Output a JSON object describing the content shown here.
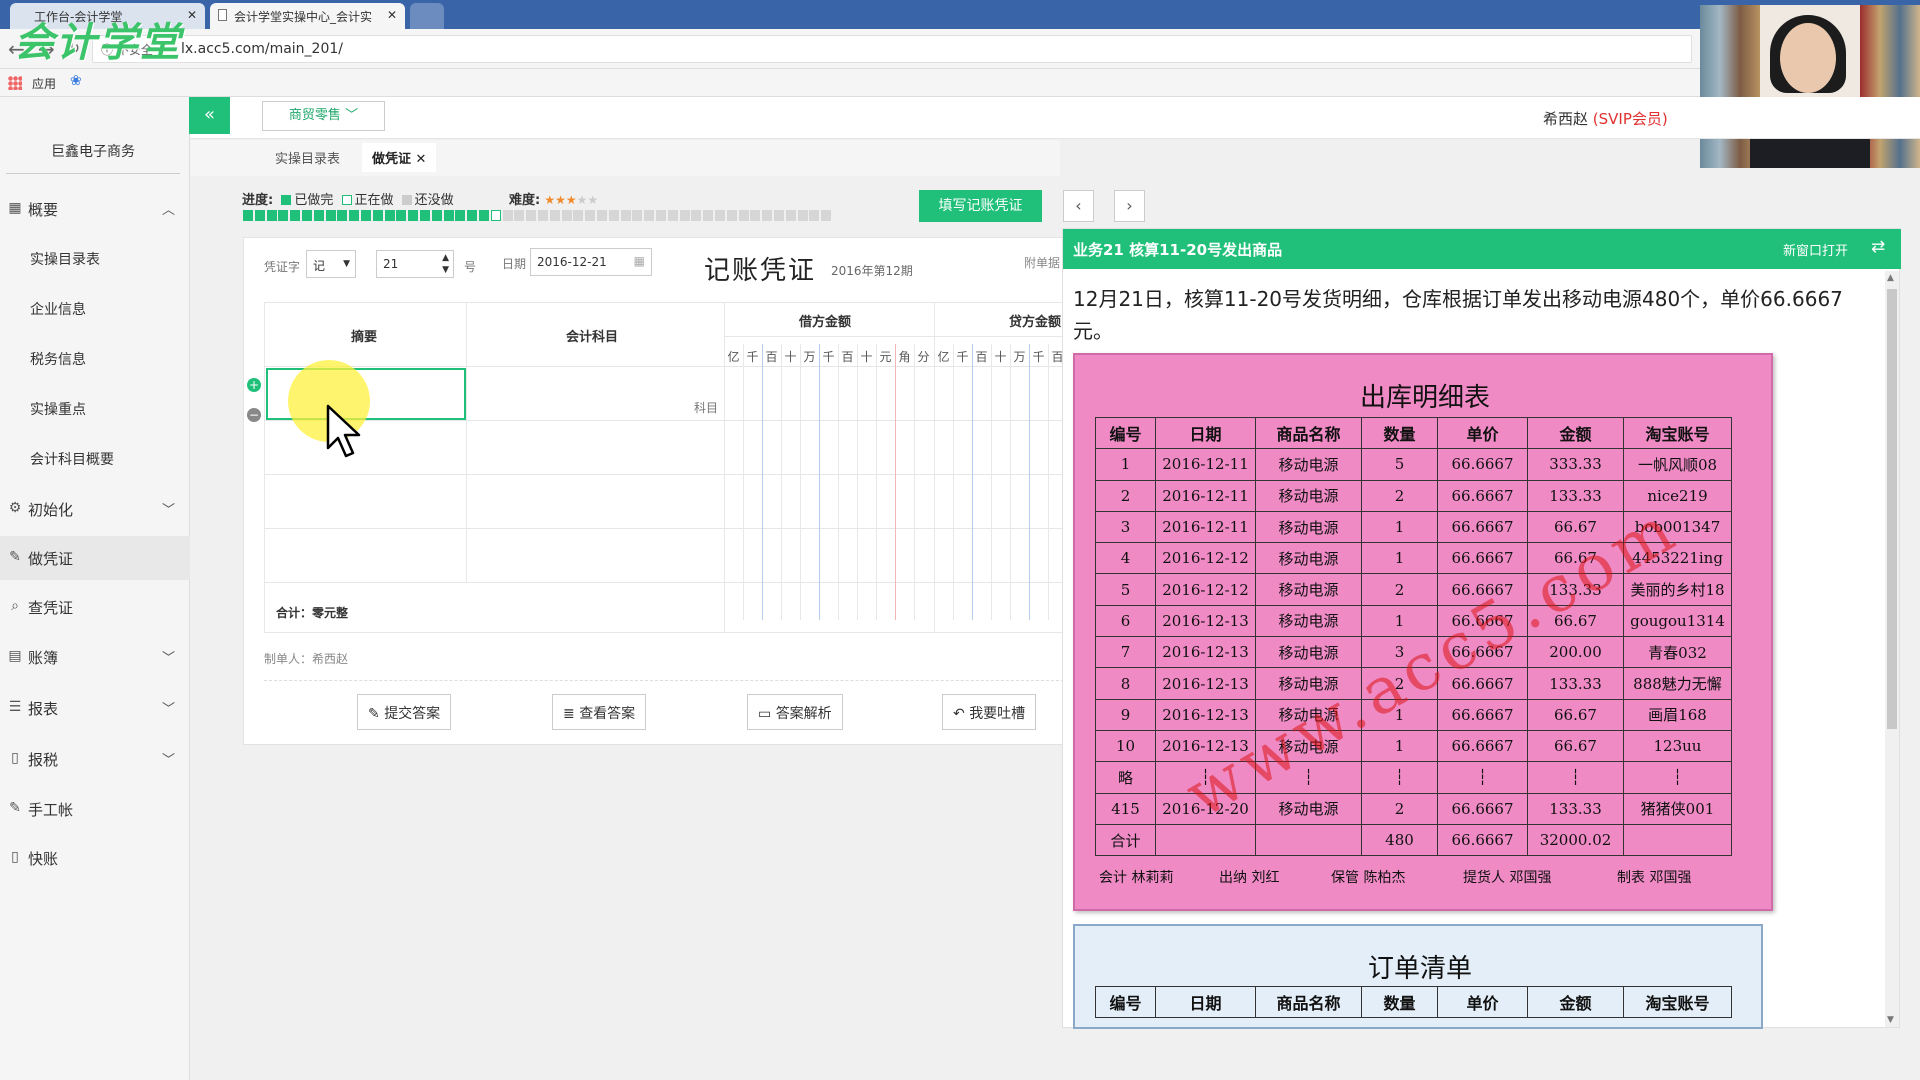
{
  "browser": {
    "tabs": [
      {
        "label": "工作台-会计学堂"
      },
      {
        "label": "会计学堂实操中心_会计实"
      }
    ],
    "insecure_label": "不安全",
    "url": "lx.acc5.com/main_201/",
    "bookmarks_apps": "应用",
    "logo_text": "会计学堂"
  },
  "sidebar": {
    "company": "巨鑫电子商务",
    "menu": [
      {
        "label": "概要",
        "icon": "grid-icon",
        "chevron": "up"
      },
      {
        "label": "初始化",
        "icon": "gear-icon",
        "chevron": "down"
      },
      {
        "label": "做凭证",
        "icon": "pencil-icon",
        "chevron": ""
      },
      {
        "label": "查凭证",
        "icon": "search-icon",
        "chevron": ""
      },
      {
        "label": "账簿",
        "icon": "book-icon",
        "chevron": "down"
      },
      {
        "label": "报表",
        "icon": "list-icon",
        "chevron": "down"
      },
      {
        "label": "报税",
        "icon": "file-icon",
        "chevron": "down"
      },
      {
        "label": "手工帐",
        "icon": "pencil-icon",
        "chevron": ""
      },
      {
        "label": "快账",
        "icon": "file-icon",
        "chevron": ""
      }
    ],
    "sub_items": [
      "实操目录表",
      "企业信息",
      "税务信息",
      "实操重点",
      "会计科目概要"
    ]
  },
  "topbar": {
    "industry": "商贸零售",
    "user_name": "希西赵",
    "user_level": "(SVIP会员)",
    "subtabs": [
      "实操目录表",
      "做凭证"
    ]
  },
  "progress": {
    "label": "进度:",
    "done": "已做完",
    "doing": "正在做",
    "todo": "还没做",
    "difficulty_label": "难度:",
    "difficulty_stars": 3,
    "difficulty_max": 5,
    "done_count": 21,
    "total_count": 50,
    "fill_button": "填写记账凭证"
  },
  "voucher": {
    "word_label": "凭证字",
    "word_value": "记",
    "number_value": "21",
    "number_suffix": "号",
    "date_label": "日期",
    "date_value": "2016-12-21",
    "title": "记账凭证",
    "period": "2016年第12期",
    "attach": "附单据",
    "col_summary": "摘要",
    "col_account": "会计科目",
    "col_debit": "借方金额",
    "col_credit": "贷方金额",
    "digits": [
      "亿",
      "千",
      "百",
      "十",
      "万",
      "千",
      "百",
      "十",
      "元",
      "角",
      "分"
    ],
    "account_hint": "科目",
    "total": "合计：零元整",
    "maker": "制单人：希西赵",
    "buttons": [
      "提交答案",
      "查看答案",
      "答案解析",
      "我要吐槽"
    ]
  },
  "business": {
    "title": "业务21 核算11-20号发出商品",
    "open_new": "新窗口打开",
    "description": "12月21日，核算11-20号发货明细，仓库根据订单发出移动电源480个，单价66.6667元。",
    "watermark": "www.acc5.com",
    "outbound": {
      "title": "出库明细表",
      "headers": [
        "编号",
        "日期",
        "商品名称",
        "数量",
        "单价",
        "金额",
        "淘宝账号"
      ],
      "rows": [
        [
          "1",
          "2016-12-11",
          "移动电源",
          "5",
          "66.6667",
          "333.33",
          "一帆风顺08"
        ],
        [
          "2",
          "2016-12-11",
          "移动电源",
          "2",
          "66.6667",
          "133.33",
          "nice219"
        ],
        [
          "3",
          "2016-12-11",
          "移动电源",
          "1",
          "66.6667",
          "66.67",
          "bob001347"
        ],
        [
          "4",
          "2016-12-12",
          "移动电源",
          "1",
          "66.6667",
          "66.67",
          "4453221ing"
        ],
        [
          "5",
          "2016-12-12",
          "移动电源",
          "2",
          "66.6667",
          "133.33",
          "美丽的乡村18"
        ],
        [
          "6",
          "2016-12-13",
          "移动电源",
          "1",
          "66.6667",
          "66.67",
          "gougou1314"
        ],
        [
          "7",
          "2016-12-13",
          "移动电源",
          "3",
          "66.6667",
          "200.00",
          "青春032"
        ],
        [
          "8",
          "2016-12-13",
          "移动电源",
          "2",
          "66.6667",
          "133.33",
          "888魅力无懈"
        ],
        [
          "9",
          "2016-12-13",
          "移动电源",
          "1",
          "66.6667",
          "66.67",
          "画眉168"
        ],
        [
          "10",
          "2016-12-13",
          "移动电源",
          "1",
          "66.6667",
          "66.67",
          "123uu"
        ],
        [
          "略",
          "┆",
          "┆",
          "┆",
          "┆",
          "┆",
          "┆"
        ],
        [
          "415",
          "2016-12-20",
          "移动电源",
          "2",
          "66.6667",
          "133.33",
          "猪猪侠001"
        ],
        [
          "合计",
          "",
          "",
          "480",
          "66.6667",
          "32000.02",
          ""
        ]
      ],
      "signatures": [
        "会计 林莉莉",
        "出纳 刘红",
        "保管 陈柏杰",
        "提货人 邓国强",
        "制表 邓国强"
      ]
    },
    "order": {
      "title": "订单清单",
      "headers": [
        "编号",
        "日期",
        "商品名称",
        "数量",
        "单价",
        "金额",
        "淘宝账号"
      ]
    }
  }
}
